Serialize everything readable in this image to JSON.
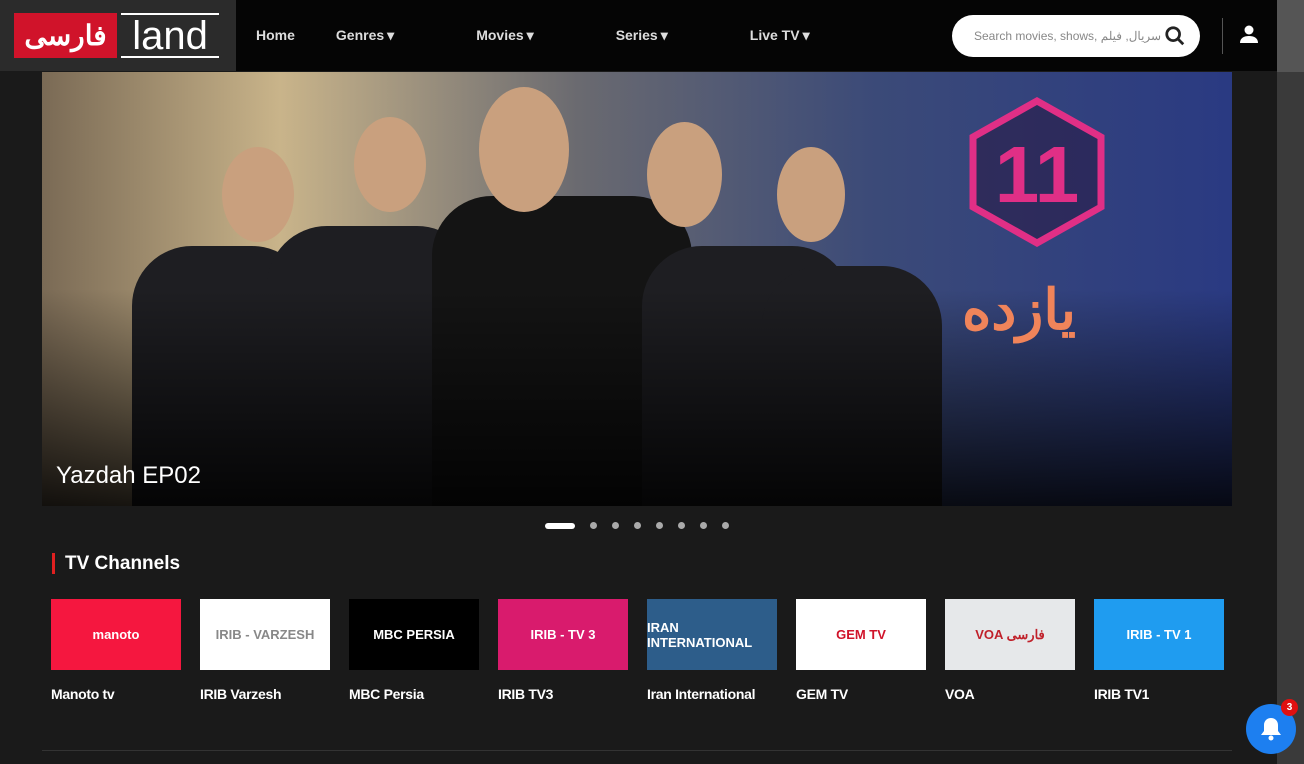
{
  "logo": {
    "fa": "فارسی",
    "en": "land"
  },
  "nav": [
    {
      "label": "Home",
      "dropdown": false
    },
    {
      "label": "Genres",
      "dropdown": true
    },
    {
      "label": "Movies",
      "dropdown": true
    },
    {
      "label": "Series",
      "dropdown": true
    },
    {
      "label": "Live TV",
      "dropdown": true
    }
  ],
  "caret": "▾",
  "search": {
    "placeholder": "Search movies, shows, سریال, فیلم"
  },
  "hero": {
    "caption": "Yazdah EP02",
    "logo_number": "11",
    "logo_text": "یازده",
    "slides": 8,
    "active_slide": 1
  },
  "section": {
    "title": "TV Channels"
  },
  "channels": [
    {
      "name": "Manoto tv",
      "logo": "manoto",
      "bg": "#f5173f",
      "fg": "#ffffff"
    },
    {
      "name": "IRIB Varzesh",
      "logo": "IRIB - VARZESH",
      "bg": "#ffffff",
      "fg": "#888888"
    },
    {
      "name": "MBC Persia",
      "logo": "MBC PERSIA",
      "bg": "#000000",
      "fg": "#ffffff"
    },
    {
      "name": "IRIB TV3",
      "logo": "IRIB - TV 3",
      "bg": "#d91b6d",
      "fg": "#ffffff"
    },
    {
      "name": "Iran International",
      "logo": "IRAN INTERNATIONAL",
      "bg": "#2d5d8a",
      "fg": "#ffffff"
    },
    {
      "name": "GEM TV",
      "logo": "GEM TV",
      "bg": "#ffffff",
      "fg": "#d0132a"
    },
    {
      "name": "VOA",
      "logo": "VOA فارسی",
      "bg": "#e6e8ea",
      "fg": "#c0202a"
    },
    {
      "name": "IRIB TV1",
      "logo": "IRIB - TV 1",
      "bg": "#1f9cf0",
      "fg": "#ffffff"
    }
  ],
  "notifications": {
    "count": "3"
  }
}
